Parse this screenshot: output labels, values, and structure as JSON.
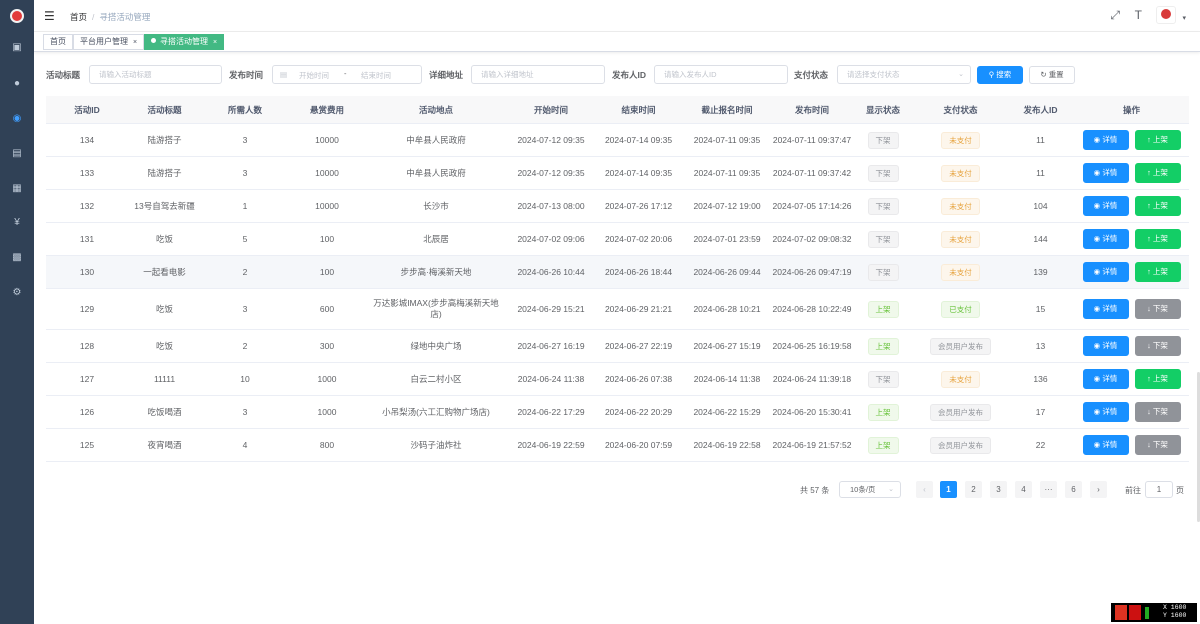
{
  "header": {
    "breadcrumb": [
      "首页",
      "寻搭活动管理"
    ],
    "separator": "/"
  },
  "tags": [
    {
      "label": "首页",
      "active": false,
      "closable": false
    },
    {
      "label": "平台用户管理",
      "active": false,
      "closable": true
    },
    {
      "label": "寻搭活动管理",
      "active": true,
      "closable": true
    }
  ],
  "search": {
    "title_label": "活动标题",
    "title_placeholder": "请输入活动标题",
    "time_label": "发布时间",
    "start_placeholder": "开始时间",
    "range_sep": "-",
    "end_placeholder": "结束时间",
    "address_label": "详细地址",
    "address_placeholder": "请输入详细地址",
    "publisher_label": "发布人ID",
    "publisher_placeholder": "请输入发布人ID",
    "pay_label": "支付状态",
    "pay_placeholder": "请选择支付状态",
    "search_btn": "搜索",
    "reset_btn": "重置"
  },
  "table": {
    "columns": [
      "活动ID",
      "活动标题",
      "所需人数",
      "悬赏费用",
      "活动地点",
      "开始时间",
      "结束时间",
      "截止报名时间",
      "发布时间",
      "显示状态",
      "支付状态",
      "发布人ID",
      "操作"
    ],
    "rows": [
      {
        "id": "134",
        "title": "陆游搭子",
        "people": "3",
        "reward": "10000",
        "location": "中牟县人民政府",
        "start": "2024-07-12 09:35",
        "end": "2024-07-14 09:35",
        "deadline": "2024-07-11 09:35",
        "published": "2024-07-11 09:37:47",
        "show": "下架",
        "show_type": "info",
        "pay": "未支付",
        "pay_type": "warning",
        "publisher": "11",
        "action": "上架",
        "action_type": "up"
      },
      {
        "id": "133",
        "title": "陆游搭子",
        "people": "3",
        "reward": "10000",
        "location": "中牟县人民政府",
        "start": "2024-07-12 09:35",
        "end": "2024-07-14 09:35",
        "deadline": "2024-07-11 09:35",
        "published": "2024-07-11 09:37:42",
        "show": "下架",
        "show_type": "info",
        "pay": "未支付",
        "pay_type": "warning",
        "publisher": "11",
        "action": "上架",
        "action_type": "up"
      },
      {
        "id": "132",
        "title": "13号自驾去新疆",
        "people": "1",
        "reward": "10000",
        "location": "长沙市",
        "start": "2024-07-13 08:00",
        "end": "2024-07-26 17:12",
        "deadline": "2024-07-12 19:00",
        "published": "2024-07-05 17:14:26",
        "show": "下架",
        "show_type": "info",
        "pay": "未支付",
        "pay_type": "warning",
        "publisher": "104",
        "action": "上架",
        "action_type": "up"
      },
      {
        "id": "131",
        "title": "吃饭",
        "people": "5",
        "reward": "100",
        "location": "北辰居",
        "start": "2024-07-02 09:06",
        "end": "2024-07-02 20:06",
        "deadline": "2024-07-01 23:59",
        "published": "2024-07-02 09:08:32",
        "show": "下架",
        "show_type": "info",
        "pay": "未支付",
        "pay_type": "warning",
        "publisher": "144",
        "action": "上架",
        "action_type": "up"
      },
      {
        "id": "130",
        "title": "一起看电影",
        "people": "2",
        "reward": "100",
        "location": "步步高·梅溪新天地",
        "start": "2024-06-26 10:44",
        "end": "2024-06-26 18:44",
        "deadline": "2024-06-26 09:44",
        "published": "2024-06-26 09:47:19",
        "show": "下架",
        "show_type": "info",
        "pay": "未支付",
        "pay_type": "warning",
        "publisher": "139",
        "action": "上架",
        "action_type": "up"
      },
      {
        "id": "129",
        "title": "吃饭",
        "people": "3",
        "reward": "600",
        "location": "万达影城IMAX(步步高梅溪新天地店)",
        "start": "2024-06-29 15:21",
        "end": "2024-06-29 21:21",
        "deadline": "2024-06-28 10:21",
        "published": "2024-06-28 10:22:49",
        "show": "上架",
        "show_type": "success",
        "pay": "已支付",
        "pay_type": "success",
        "publisher": "15",
        "action": "下架",
        "action_type": "down"
      },
      {
        "id": "128",
        "title": "吃饭",
        "people": "2",
        "reward": "300",
        "location": "绿地中央广场",
        "start": "2024-06-27 16:19",
        "end": "2024-06-27 22:19",
        "deadline": "2024-06-27 15:19",
        "published": "2024-06-25 16:19:58",
        "show": "上架",
        "show_type": "success",
        "pay": "会员用户发布",
        "pay_type": "info",
        "publisher": "13",
        "action": "下架",
        "action_type": "down"
      },
      {
        "id": "127",
        "title": "11111",
        "people": "10",
        "reward": "1000",
        "location": "白云二村小区",
        "start": "2024-06-24 11:38",
        "end": "2024-06-26 07:38",
        "deadline": "2024-06-14 11:38",
        "published": "2024-06-24 11:39:18",
        "show": "下架",
        "show_type": "info",
        "pay": "未支付",
        "pay_type": "warning",
        "publisher": "136",
        "action": "上架",
        "action_type": "up"
      },
      {
        "id": "126",
        "title": "吃饭喝酒",
        "people": "3",
        "reward": "1000",
        "location": "小吊梨汤(六工汇购物广场店)",
        "start": "2024-06-22 17:29",
        "end": "2024-06-22 20:29",
        "deadline": "2024-06-22 15:29",
        "published": "2024-06-20 15:30:41",
        "show": "上架",
        "show_type": "success",
        "pay": "会员用户发布",
        "pay_type": "info",
        "publisher": "17",
        "action": "下架",
        "action_type": "down"
      },
      {
        "id": "125",
        "title": "夜宵喝酒",
        "people": "4",
        "reward": "800",
        "location": "沙码子油炸社",
        "start": "2024-06-19 22:59",
        "end": "2024-06-20 07:59",
        "deadline": "2024-06-19 22:58",
        "published": "2024-06-19 21:57:52",
        "show": "上架",
        "show_type": "success",
        "pay": "会员用户发布",
        "pay_type": "info",
        "publisher": "22",
        "action": "下架",
        "action_type": "down"
      }
    ],
    "detail_label": "详情"
  },
  "pagination": {
    "total_text": "共 57 条",
    "page_size": "10条/页",
    "pages": [
      "1",
      "2",
      "3",
      "4",
      "···",
      "6"
    ],
    "current": "1",
    "goto_label": "前往",
    "goto_value": "1",
    "page_suffix": "页"
  },
  "status_overlay": {
    "x_text": "X 1600",
    "y_text": "Y 1600"
  },
  "colors": {
    "sidebar": "#304156",
    "primary": "#1890ff",
    "success": "#13ce66",
    "tag_active": "#42b983",
    "warning_text": "#e6a23c"
  }
}
